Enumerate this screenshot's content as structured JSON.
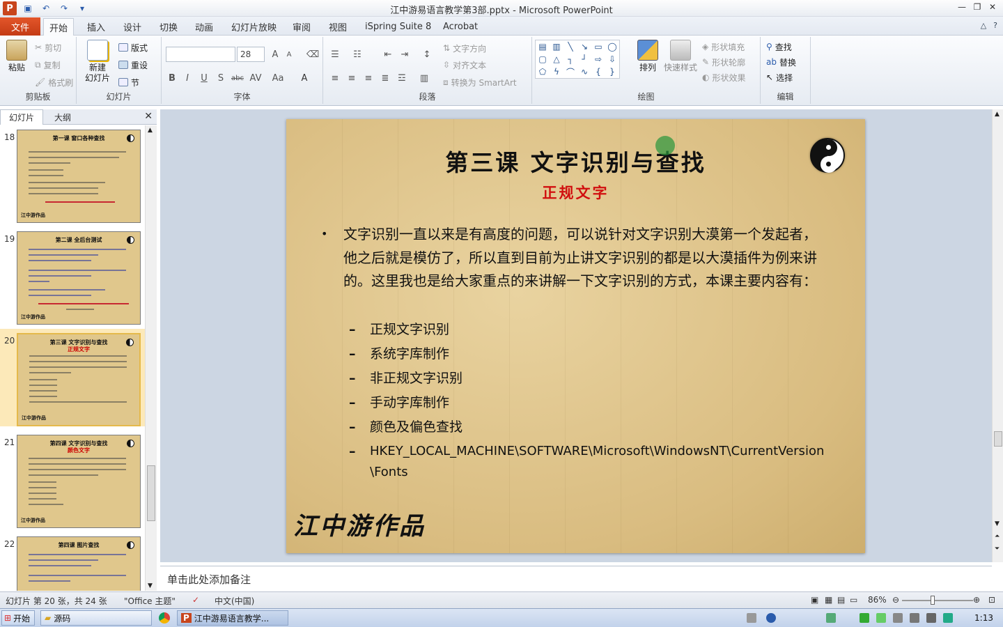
{
  "window": {
    "title": "江中游易语言教学第3部.pptx - Microsoft PowerPoint"
  },
  "quick_access": {
    "app_icon": "P"
  },
  "tabs": {
    "file": "文件",
    "items": [
      "开始",
      "插入",
      "设计",
      "切换",
      "动画",
      "幻灯片放映",
      "审阅",
      "视图",
      "iSpring Suite 8",
      "Acrobat"
    ],
    "active": "开始"
  },
  "ribbon": {
    "clipboard": {
      "label": "剪贴板",
      "paste": "粘贴",
      "cut": "剪切",
      "copy": "复制",
      "format_painter": "格式刷"
    },
    "slides": {
      "label": "幻灯片",
      "new_slide_1": "新建",
      "new_slide_2": "幻灯片",
      "layout": "版式",
      "reset": "重设",
      "section": "节"
    },
    "font": {
      "label": "字体",
      "font_name": "",
      "font_size": "28"
    },
    "paragraph": {
      "label": "段落",
      "text_direction": "文字方向",
      "align_text": "对齐文本",
      "convert_smartart": "转换为 SmartArt"
    },
    "drawing": {
      "label": "绘图",
      "arrange": "排列",
      "quick_styles": "快速样式",
      "shape_fill": "形状填充",
      "shape_outline": "形状轮廓",
      "shape_effects": "形状效果"
    },
    "editing": {
      "label": "编辑",
      "find": "查找",
      "replace": "替换",
      "select": "选择"
    }
  },
  "pane": {
    "tab_slides": "幻灯片",
    "tab_outline": "大纲"
  },
  "thumbnails": [
    {
      "num": "18",
      "title": "第一课 窗口各种查找"
    },
    {
      "num": "19",
      "title": "第二课 全后台测试"
    },
    {
      "num": "20",
      "title": "第三课 文字识别与查找",
      "sub": "正规文字"
    },
    {
      "num": "21",
      "title": "第四课 文字识别与查找",
      "sub": "颜色文字"
    },
    {
      "num": "22",
      "title": "第四课 图片查找"
    }
  ],
  "slide": {
    "title": "第三课 文字识别与查找",
    "subtitle": "正规文字",
    "bullet_text": "文字识别一直以来是有高度的问题，可以说针对文字识别大漠第一个发起者，他之后就是模仿了，所以直到目前为止讲文字识别的都是以大漠插件为例来讲的。这里我也是给大家重点的来讲解一下文字识别的方式，本课主要内容有：",
    "sub_items": [
      "正规文字识别",
      "系统字库制作",
      "非正规文字识别",
      "手动字库制作",
      "颜色及偏色查找",
      "HKEY_LOCAL_MACHINE\\SOFTWARE\\Microsoft\\WindowsNT\\CurrentVersion\\Fonts"
    ],
    "signature": "江中游作品",
    "thumb_signature": "江中游作品"
  },
  "notes": {
    "placeholder": "单击此处添加备注"
  },
  "status": {
    "slide_info": "幻灯片 第 20 张，共 24 张",
    "theme": "\"Office 主题\"",
    "language": "中文(中国)",
    "zoom": "86%"
  },
  "taskbar": {
    "start": "开始",
    "folder": "源码",
    "ppt": "江中游易语言教学...",
    "clock": "1:13"
  }
}
